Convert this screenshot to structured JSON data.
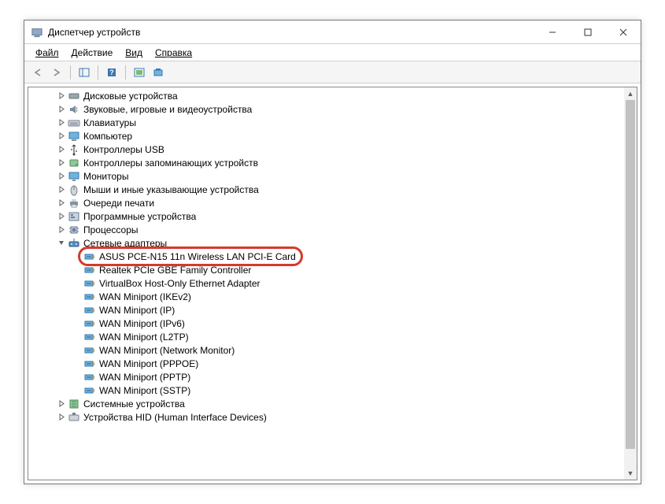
{
  "window": {
    "title": "Диспетчер устройств"
  },
  "menu": {
    "file": "Файл",
    "action": "Действие",
    "view": "Вид",
    "help": "Справка"
  },
  "controls": {
    "minimize": "—",
    "maximize": "☐",
    "close": "✕"
  },
  "tree": {
    "items": [
      {
        "indent": 1,
        "label": "Дисковые устройства",
        "expand": "closed",
        "icon": "disk"
      },
      {
        "indent": 1,
        "label": "Звуковые, игровые и видеоустройства",
        "expand": "closed",
        "icon": "audio"
      },
      {
        "indent": 1,
        "label": "Клавиатуры",
        "expand": "closed",
        "icon": "keyboard"
      },
      {
        "indent": 1,
        "label": "Компьютер",
        "expand": "closed",
        "icon": "computer"
      },
      {
        "indent": 1,
        "label": "Контроллеры USB",
        "expand": "closed",
        "icon": "usb"
      },
      {
        "indent": 1,
        "label": "Контроллеры запоминающих устройств",
        "expand": "closed",
        "icon": "storage"
      },
      {
        "indent": 1,
        "label": "Мониторы",
        "expand": "closed",
        "icon": "monitor"
      },
      {
        "indent": 1,
        "label": "Мыши и иные указывающие устройства",
        "expand": "closed",
        "icon": "mouse"
      },
      {
        "indent": 1,
        "label": "Очереди печати",
        "expand": "closed",
        "icon": "printer"
      },
      {
        "indent": 1,
        "label": "Программные устройства",
        "expand": "closed",
        "icon": "software"
      },
      {
        "indent": 1,
        "label": "Процессоры",
        "expand": "closed",
        "icon": "cpu"
      },
      {
        "indent": 1,
        "label": "Сетевые адаптеры",
        "expand": "open",
        "icon": "network"
      },
      {
        "indent": 2,
        "label": "ASUS PCE-N15 11n Wireless LAN PCI-E Card",
        "expand": "none",
        "icon": "netadapter",
        "highlighted": true
      },
      {
        "indent": 2,
        "label": "Realtek PCIe GBE Family Controller",
        "expand": "none",
        "icon": "netadapter"
      },
      {
        "indent": 2,
        "label": "VirtualBox Host-Only Ethernet Adapter",
        "expand": "none",
        "icon": "netadapter"
      },
      {
        "indent": 2,
        "label": "WAN Miniport (IKEv2)",
        "expand": "none",
        "icon": "netadapter"
      },
      {
        "indent": 2,
        "label": "WAN Miniport (IP)",
        "expand": "none",
        "icon": "netadapter"
      },
      {
        "indent": 2,
        "label": "WAN Miniport (IPv6)",
        "expand": "none",
        "icon": "netadapter"
      },
      {
        "indent": 2,
        "label": "WAN Miniport (L2TP)",
        "expand": "none",
        "icon": "netadapter"
      },
      {
        "indent": 2,
        "label": "WAN Miniport (Network Monitor)",
        "expand": "none",
        "icon": "netadapter"
      },
      {
        "indent": 2,
        "label": "WAN Miniport (PPPOE)",
        "expand": "none",
        "icon": "netadapter"
      },
      {
        "indent": 2,
        "label": "WAN Miniport (PPTP)",
        "expand": "none",
        "icon": "netadapter"
      },
      {
        "indent": 2,
        "label": "WAN Miniport (SSTP)",
        "expand": "none",
        "icon": "netadapter"
      },
      {
        "indent": 1,
        "label": "Системные устройства",
        "expand": "closed",
        "icon": "system"
      },
      {
        "indent": 1,
        "label": "Устройства HID (Human Interface Devices)",
        "expand": "closed",
        "icon": "hid"
      }
    ]
  }
}
